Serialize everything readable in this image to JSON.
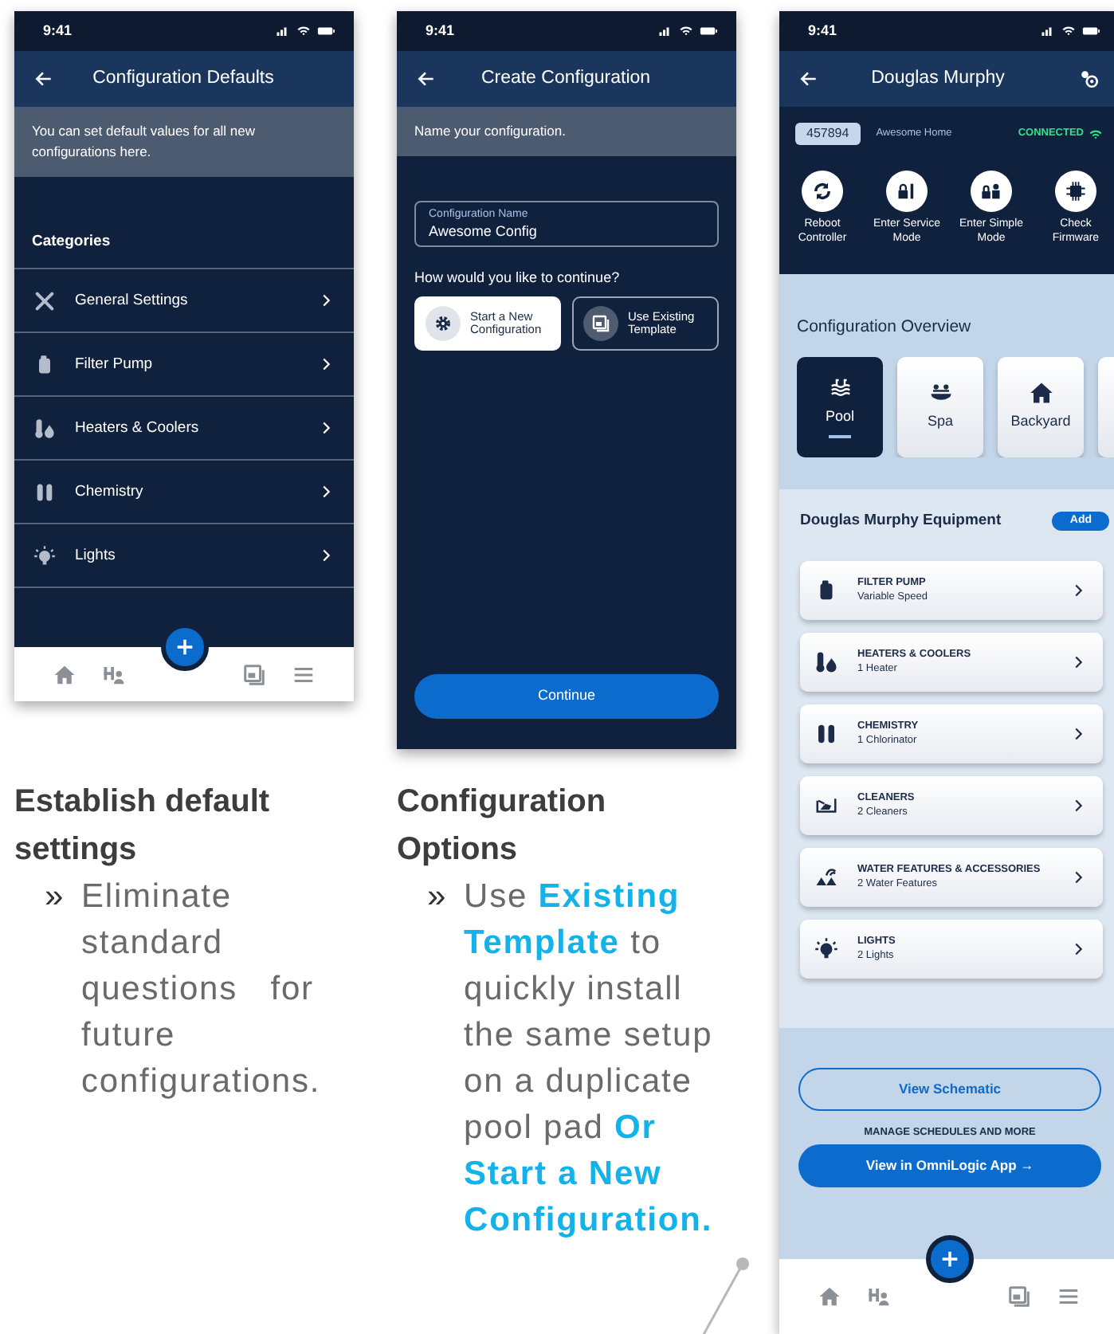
{
  "defaults": {
    "status_time": "9:41",
    "title": "Configuration Defaults",
    "info": "You can set default values for all new configurations here.",
    "section_heading": "Categories",
    "categories": [
      {
        "label": "General Settings"
      },
      {
        "label": "Filter Pump"
      },
      {
        "label": "Heaters & Coolers"
      },
      {
        "label": "Chemistry"
      },
      {
        "label": "Lights"
      }
    ]
  },
  "create": {
    "status_time": "9:41",
    "title": "Create Configuration",
    "info": "Name your configuration.",
    "field": {
      "label": "Configuration Name",
      "value": "Awesome Config"
    },
    "question": "How would you like to continue?",
    "options": [
      {
        "label": "Start a New Configuration",
        "selected": true
      },
      {
        "label": "Use Existing Template",
        "selected": false
      }
    ],
    "continue_button": "Continue"
  },
  "detail": {
    "status_time": "9:41",
    "title": "Douglas Murphy",
    "controller_id": "457894",
    "site_name": "Awesome Home",
    "connection": "CONNECTED",
    "actions": [
      {
        "label": "Reboot Controller"
      },
      {
        "label": "Enter Service Mode"
      },
      {
        "label": "Enter Simple Mode"
      },
      {
        "label": "Check Firmware"
      }
    ],
    "overview_heading": "Configuration Overview",
    "zones": [
      {
        "label": "Pool",
        "selected": true
      },
      {
        "label": "Spa",
        "selected": false
      },
      {
        "label": "Backyard",
        "selected": false
      },
      {
        "selected": false
      }
    ],
    "equipment_heading": "Douglas Murphy Equipment",
    "add_button": "Add",
    "equipment": [
      {
        "name": "FILTER PUMP",
        "detail": "Variable Speed"
      },
      {
        "name": "HEATERS & COOLERS",
        "detail": "1 Heater"
      },
      {
        "name": "CHEMISTRY",
        "detail": "1 Chlorinator"
      },
      {
        "name": "CLEANERS",
        "detail": "2 Cleaners"
      },
      {
        "name": "WATER FEATURES & ACCESSORIES",
        "detail": "2 Water Features"
      },
      {
        "name": "LIGHTS",
        "detail": "2 Lights"
      }
    ],
    "schematic_button": "View Schematic",
    "manage_label": "MANAGE SCHEDULES AND MORE",
    "app_button": "View in OmniLogic App →"
  },
  "captions": [
    {
      "heading": "Establish default settings",
      "bullet": "»",
      "text": "Eliminate standard questions for future configurations."
    },
    {
      "heading": "Configuration Options",
      "bullet": "»",
      "text": "Use **Existing Template** to quickly install the same setup on a duplicate pool pad **Or Start a New Configuration.**"
    }
  ]
}
